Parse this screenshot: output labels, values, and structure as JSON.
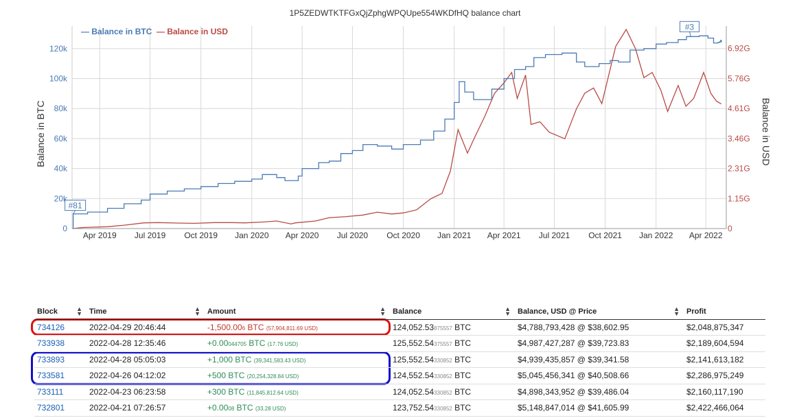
{
  "chart_data": {
    "type": "line",
    "title": "1P5ZEDWTKTFGxQjZphgWPQUpe554WKDfHQ balance chart",
    "ylabel_left": "Balance in BTC",
    "ylabel_right": "Balance in USD",
    "legend": [
      {
        "name": "Balance in BTC",
        "color": "#4a7ab5"
      },
      {
        "name": "Balance in USD",
        "color": "#b84a45"
      }
    ],
    "legend_position": "top-left",
    "x_range": [
      "2019-02-10",
      "2022-05-08"
    ],
    "x_ticks": [
      "Apr 2019",
      "Jul 2019",
      "Oct 2019",
      "Jan 2020",
      "Apr 2020",
      "Jul 2020",
      "Oct 2020",
      "Jan 2021",
      "Apr 2021",
      "Jul 2021",
      "Oct 2021",
      "Jan 2022",
      "Apr 2022"
    ],
    "y_left_ticks": [
      "0",
      "20k",
      "40k",
      "60k",
      "80k",
      "100k",
      "120k"
    ],
    "y_left_range": [
      0,
      135000
    ],
    "y_right_ticks": [
      "0",
      "1.15G",
      "2.31G",
      "3.46G",
      "4.61G",
      "5.76G",
      "6.92G"
    ],
    "y_right_range": [
      0,
      7780000000
    ],
    "grid": true,
    "series": [
      {
        "name": "Balance in BTC",
        "color": "#4a7ab5",
        "points": [
          [
            "2019-02-10",
            0
          ],
          [
            "2019-02-12",
            9800
          ],
          [
            "2019-03-10",
            11000
          ],
          [
            "2019-04-15",
            13500
          ],
          [
            "2019-05-15",
            16500
          ],
          [
            "2019-06-15",
            19000
          ],
          [
            "2019-07-01",
            23000
          ],
          [
            "2019-08-01",
            25000
          ],
          [
            "2019-09-01",
            26500
          ],
          [
            "2019-10-01",
            28000
          ],
          [
            "2019-11-01",
            30000
          ],
          [
            "2019-12-01",
            31500
          ],
          [
            "2020-01-01",
            33000
          ],
          [
            "2020-01-20",
            36000
          ],
          [
            "2020-02-15",
            34000
          ],
          [
            "2020-03-01",
            32000
          ],
          [
            "2020-03-25",
            35000
          ],
          [
            "2020-04-01",
            40000
          ],
          [
            "2020-05-01",
            44000
          ],
          [
            "2020-05-20",
            45000
          ],
          [
            "2020-06-10",
            50000
          ],
          [
            "2020-07-01",
            52000
          ],
          [
            "2020-07-20",
            56000
          ],
          [
            "2020-08-15",
            55000
          ],
          [
            "2020-09-10",
            53000
          ],
          [
            "2020-10-01",
            56000
          ],
          [
            "2020-11-01",
            59000
          ],
          [
            "2020-11-25",
            65000
          ],
          [
            "2020-12-15",
            73000
          ],
          [
            "2021-01-01",
            84000
          ],
          [
            "2021-01-10",
            98000
          ],
          [
            "2021-01-20",
            91000
          ],
          [
            "2021-02-05",
            86000
          ],
          [
            "2021-02-20",
            86000
          ],
          [
            "2021-03-10",
            93000
          ],
          [
            "2021-04-01",
            100000
          ],
          [
            "2021-04-20",
            106000
          ],
          [
            "2021-05-10",
            108000
          ],
          [
            "2021-05-25",
            114000
          ],
          [
            "2021-06-15",
            116000
          ],
          [
            "2021-07-15",
            117000
          ],
          [
            "2021-08-10",
            111000
          ],
          [
            "2021-08-25",
            108000
          ],
          [
            "2021-09-20",
            110000
          ],
          [
            "2021-10-10",
            112000
          ],
          [
            "2021-10-25",
            111000
          ],
          [
            "2021-11-15",
            119000
          ],
          [
            "2021-12-10",
            120000
          ],
          [
            "2022-01-01",
            123000
          ],
          [
            "2022-01-20",
            124000
          ],
          [
            "2022-02-10",
            126000
          ],
          [
            "2022-02-25",
            128000
          ],
          [
            "2022-03-20",
            128500
          ],
          [
            "2022-04-05",
            127000
          ],
          [
            "2022-04-15",
            123752
          ],
          [
            "2022-04-23",
            124052
          ],
          [
            "2022-04-26",
            124552
          ],
          [
            "2022-04-28",
            125552
          ],
          [
            "2022-04-29",
            124052
          ]
        ]
      },
      {
        "name": "Balance in USD",
        "color": "#b84a45",
        "points": [
          [
            "2019-02-10",
            0
          ],
          [
            "2019-03-01",
            40000000
          ],
          [
            "2019-04-15",
            70000000
          ],
          [
            "2019-05-15",
            130000000
          ],
          [
            "2019-06-20",
            220000000
          ],
          [
            "2019-07-15",
            230000000
          ],
          [
            "2019-08-20",
            210000000
          ],
          [
            "2019-09-20",
            200000000
          ],
          [
            "2019-10-25",
            230000000
          ],
          [
            "2019-11-25",
            230000000
          ],
          [
            "2019-12-20",
            220000000
          ],
          [
            "2020-01-20",
            250000000
          ],
          [
            "2020-02-15",
            290000000
          ],
          [
            "2020-03-12",
            180000000
          ],
          [
            "2020-03-20",
            220000000
          ],
          [
            "2020-04-25",
            290000000
          ],
          [
            "2020-05-20",
            420000000
          ],
          [
            "2020-06-20",
            460000000
          ],
          [
            "2020-07-20",
            520000000
          ],
          [
            "2020-08-15",
            630000000
          ],
          [
            "2020-09-10",
            560000000
          ],
          [
            "2020-10-01",
            600000000
          ],
          [
            "2020-10-25",
            720000000
          ],
          [
            "2020-11-20",
            1150000000
          ],
          [
            "2020-12-10",
            1350000000
          ],
          [
            "2020-12-25",
            2200000000
          ],
          [
            "2021-01-08",
            3800000000
          ],
          [
            "2021-01-25",
            2900000000
          ],
          [
            "2021-02-08",
            3550000000
          ],
          [
            "2021-02-25",
            4300000000
          ],
          [
            "2021-03-15",
            5200000000
          ],
          [
            "2021-04-01",
            5600000000
          ],
          [
            "2021-04-15",
            6000000000
          ],
          [
            "2021-04-25",
            5000000000
          ],
          [
            "2021-05-10",
            5900000000
          ],
          [
            "2021-05-20",
            4000000000
          ],
          [
            "2021-06-05",
            4100000000
          ],
          [
            "2021-06-22",
            3700000000
          ],
          [
            "2021-07-20",
            3450000000
          ],
          [
            "2021-08-10",
            4600000000
          ],
          [
            "2021-08-25",
            5200000000
          ],
          [
            "2021-09-10",
            5400000000
          ],
          [
            "2021-09-25",
            4800000000
          ],
          [
            "2021-10-20",
            7000000000
          ],
          [
            "2021-11-08",
            7650000000
          ],
          [
            "2021-11-25",
            6900000000
          ],
          [
            "2021-12-10",
            5800000000
          ],
          [
            "2021-12-25",
            6000000000
          ],
          [
            "2022-01-10",
            5300000000
          ],
          [
            "2022-01-22",
            4500000000
          ],
          [
            "2022-02-10",
            5500000000
          ],
          [
            "2022-02-24",
            4700000000
          ],
          [
            "2022-03-10",
            5000000000
          ],
          [
            "2022-03-28",
            6000000000
          ],
          [
            "2022-04-10",
            5200000000
          ],
          [
            "2022-04-20",
            4900000000
          ],
          [
            "2022-04-29",
            4788793428
          ]
        ]
      }
    ],
    "annotations": [
      {
        "label": "#81",
        "date": "2019-02-12",
        "series": "Balance in BTC"
      },
      {
        "label": "#3",
        "date": "2022-03-05",
        "series": "Balance in BTC"
      }
    ]
  },
  "table": {
    "columns": [
      "Block",
      "Time",
      "Amount",
      "Balance",
      "Balance, USD @ Price",
      "Profit"
    ],
    "rows": [
      {
        "block": "734126",
        "time": "2022-04-29 20:46:44",
        "amount_main": "-1,500.00",
        "amount_small": "6",
        "amount_unit": " BTC ",
        "amount_usd": "(57,904,811.69 USD)",
        "amount_sign": "neg",
        "balance_main": "124,052.53",
        "balance_small": "875557",
        "balance_unit": " BTC",
        "balance_usd": "$4,788,793,428 @ $38,602.95",
        "profit": "$2,048,875,347"
      },
      {
        "block": "733938",
        "time": "2022-04-28 12:35:46",
        "amount_main": "+0.00",
        "amount_small": "044705",
        "amount_unit": " BTC ",
        "amount_usd": "(17.76 USD)",
        "amount_sign": "pos",
        "balance_main": "125,552.54",
        "balance_small": "375557",
        "balance_unit": " BTC",
        "balance_usd": "$4,987,427,287 @ $39,723.83",
        "profit": "$2,189,604,594"
      },
      {
        "block": "733893",
        "time": "2022-04-28 05:05:03",
        "amount_main": "+1,000 BTC",
        "amount_small": "",
        "amount_unit": " ",
        "amount_usd": "(39,341,583.43 USD)",
        "amount_sign": "pos",
        "balance_main": "125,552.54",
        "balance_small": "330852",
        "balance_unit": " BTC",
        "balance_usd": "$4,939,435,857 @ $39,341.58",
        "profit": "$2,141,613,182"
      },
      {
        "block": "733581",
        "time": "2022-04-26 04:12:02",
        "amount_main": "+500 BTC",
        "amount_small": "",
        "amount_unit": " ",
        "amount_usd": "(20,254,328.84 USD)",
        "amount_sign": "pos",
        "balance_main": "124,552.54",
        "balance_small": "330852",
        "balance_unit": " BTC",
        "balance_usd": "$5,045,456,341 @ $40,508.66",
        "profit": "$2,286,975,249"
      },
      {
        "block": "733111",
        "time": "2022-04-23 06:23:58",
        "amount_main": "+300 BTC",
        "amount_small": "",
        "amount_unit": " ",
        "amount_usd": "(11,845,812.64 USD)",
        "amount_sign": "pos",
        "balance_main": "124,052.54",
        "balance_small": "330852",
        "balance_unit": " BTC",
        "balance_usd": "$4,898,343,952 @ $39,486.04",
        "profit": "$2,160,117,190"
      },
      {
        "block": "732801",
        "time": "2022-04-21 07:26:57",
        "amount_main": "+0.00",
        "amount_small": "08",
        "amount_unit": " BTC ",
        "amount_usd": "(33.28 USD)",
        "amount_sign": "pos",
        "balance_main": "123,752.54",
        "balance_small": "330852",
        "balance_unit": " BTC",
        "balance_usd": "$5,148,847,014 @ $41,605.99",
        "profit": "$2,422,466,064"
      }
    ]
  },
  "colors": {
    "btc_line": "#4a7ab5",
    "usd_line": "#b84a45",
    "highlight_red": "#e01010",
    "highlight_blue": "#1010c8",
    "link": "#1a5fb4"
  },
  "icons": {
    "sort": "sort-icon"
  }
}
